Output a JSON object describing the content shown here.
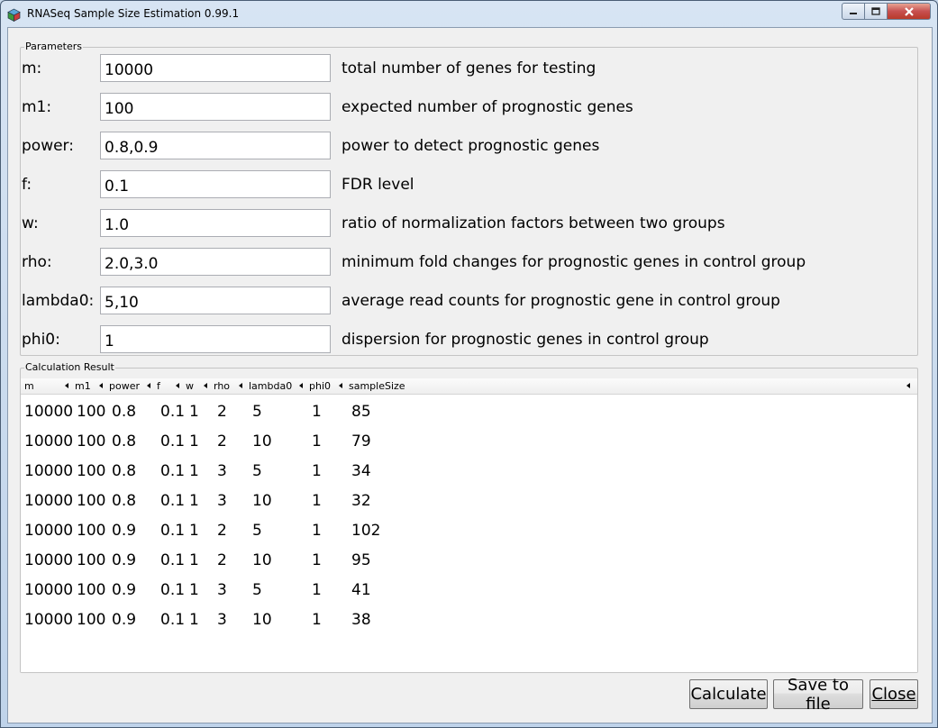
{
  "window": {
    "title": "RNASeq Sample Size Estimation 0.99.1",
    "icon": "app-cube-icon",
    "controls": [
      "minimize-icon",
      "maximize-icon",
      "close-icon"
    ]
  },
  "parameters": {
    "title": "Parameters",
    "rows": [
      {
        "label": "m:",
        "value": "10000",
        "description": "total number of genes for testing"
      },
      {
        "label": "m1:",
        "value": "100",
        "description": "expected number of prognostic genes"
      },
      {
        "label": "power:",
        "value": "0.8,0.9",
        "description": "power to detect prognostic genes"
      },
      {
        "label": "f:",
        "value": "0.1",
        "description": "FDR level"
      },
      {
        "label": "w:",
        "value": "1.0",
        "description": "ratio of normalization factors between two groups"
      },
      {
        "label": "rho:",
        "value": "2.0,3.0",
        "description": "minimum fold changes for prognostic genes in control group"
      },
      {
        "label": "lambda0:",
        "value": "5,10",
        "description": "average read counts for prognostic gene in control group"
      },
      {
        "label": "phi0:",
        "value": "1",
        "description": "dispersion for prognostic genes in control group"
      }
    ]
  },
  "results": {
    "title": "Calculation Result",
    "columns": [
      "m",
      "m1",
      "power",
      "f",
      "w",
      "rho",
      "lambda0",
      "phi0",
      "sampleSize"
    ],
    "rows": [
      [
        "10000",
        "100",
        "0.8",
        "0.1",
        "1",
        "2",
        "5",
        "1",
        "85"
      ],
      [
        "10000",
        "100",
        "0.8",
        "0.1",
        "1",
        "2",
        "10",
        "1",
        "79"
      ],
      [
        "10000",
        "100",
        "0.8",
        "0.1",
        "1",
        "3",
        "5",
        "1",
        "34"
      ],
      [
        "10000",
        "100",
        "0.8",
        "0.1",
        "1",
        "3",
        "10",
        "1",
        "32"
      ],
      [
        "10000",
        "100",
        "0.9",
        "0.1",
        "1",
        "2",
        "5",
        "1",
        "102"
      ],
      [
        "10000",
        "100",
        "0.9",
        "0.1",
        "1",
        "2",
        "10",
        "1",
        "95"
      ],
      [
        "10000",
        "100",
        "0.9",
        "0.1",
        "1",
        "3",
        "5",
        "1",
        "41"
      ],
      [
        "10000",
        "100",
        "0.9",
        "0.1",
        "1",
        "3",
        "10",
        "1",
        "38"
      ]
    ]
  },
  "buttons": {
    "calculate": "Calculate",
    "save": "Save to file",
    "close": "Close"
  }
}
